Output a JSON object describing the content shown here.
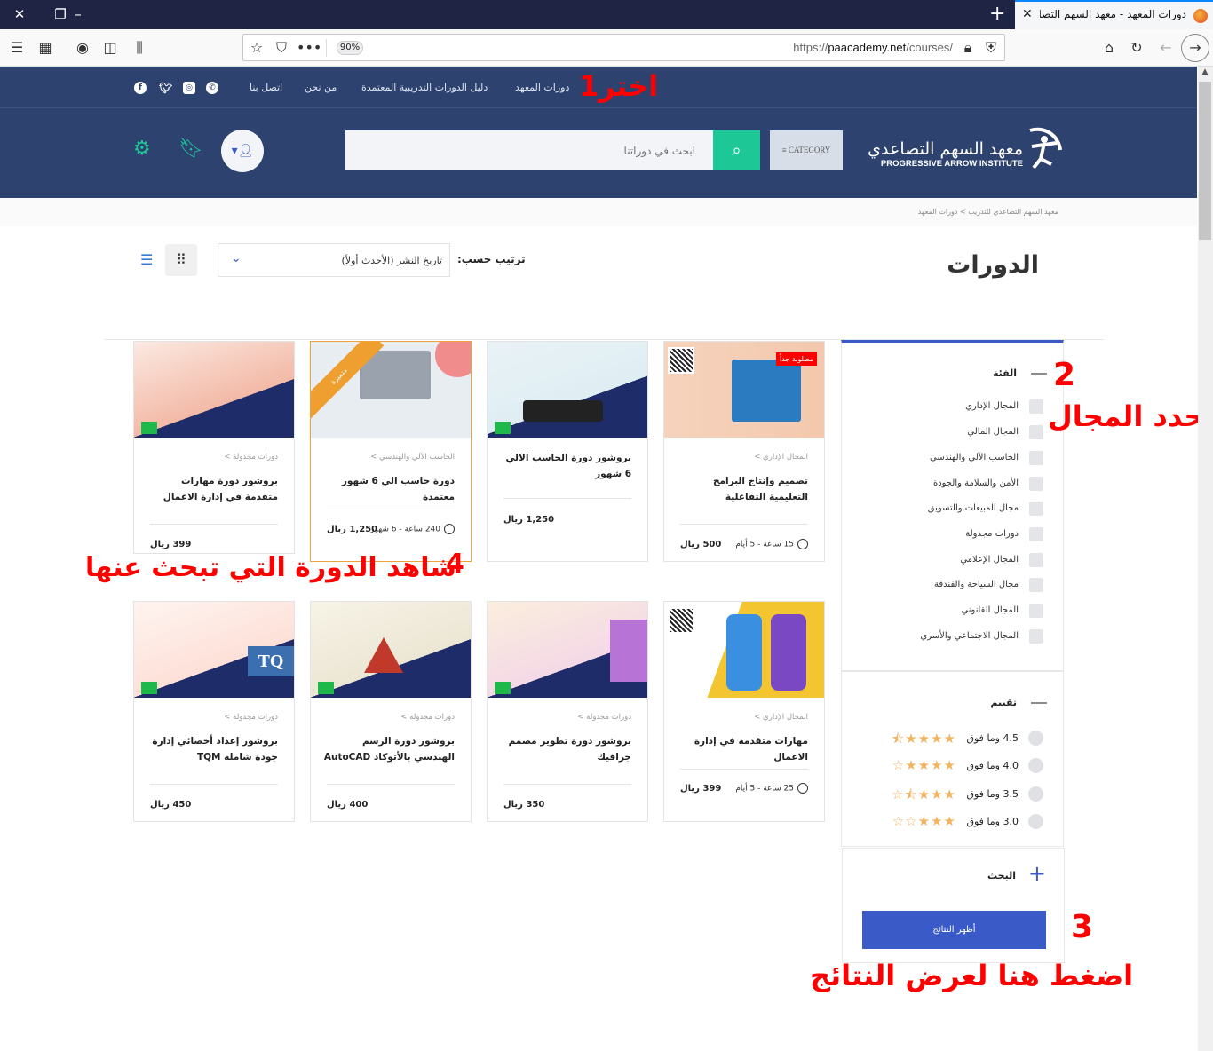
{
  "browser": {
    "tab_title": "دورات المعهد - معهد السهم التصا",
    "url_prefix": "https://",
    "url_domain": "paacademy.net",
    "url_path": "/courses/",
    "zoom_level": "90%"
  },
  "topnav": {
    "items": [
      "دورات المعهد",
      "دليل الدورات التدريبية المعتمدة",
      "من نحن",
      "اتصل بنا"
    ],
    "social": [
      "whatsapp-icon",
      "instagram-icon",
      "twitter-icon",
      "facebook-icon"
    ]
  },
  "header": {
    "logo_ar": "معهد السهم التصاعدي",
    "logo_en": "PROGRESSIVE ARROW INSTITUTE",
    "category_label": "≡ CATEGORY",
    "search_placeholder": "ابحث في دوراتنا"
  },
  "breadcrumb": "معهد السهم التصاعدي للتدريب > دورات المعهد",
  "page_title": "الدورات",
  "sort": {
    "label": "ترتيب حسب:",
    "selected": "تاريخ النشر (الأحدث أولاً)"
  },
  "filters": {
    "category_heading": "الفئة",
    "categories": [
      "المجال الإداري",
      "المجال المالي",
      "الحاسب الآلي والهندسي",
      "الأمن والسلامة والجودة",
      "مجال المبيعات والتسويق",
      "دورات مجدولة",
      "المجال الإعلامي",
      "مجال السياحة والفندقة",
      "المجال القانوني",
      "المجال الاجتماعي والأسري"
    ],
    "rating_heading": "تقييم",
    "ratings": [
      {
        "label": "4.5 وما فوق",
        "stars": 4.5
      },
      {
        "label": "4.0 وما فوق",
        "stars": 4.0
      },
      {
        "label": "3.5 وما فوق",
        "stars": 3.5
      },
      {
        "label": "3.0 وما فوق",
        "stars": 3.0
      }
    ],
    "search_heading": "البحث",
    "show_results": "أظهر النتائج"
  },
  "courses": [
    {
      "category": "المجال الإداري >",
      "title": "تصميم وإنتاج البرامج التعليمية التفاعلية",
      "meta": "15 ساعة - 5 أيام",
      "price": "500 ريال",
      "badge": "مطلوبة جداً"
    },
    {
      "category": "",
      "title": "بروشور دورة الحاسب الالي 6 شهور",
      "meta": "",
      "price": "1,250 ريال",
      "badge": ""
    },
    {
      "category": "الحاسب الآلي والهندسي >",
      "title": "دورة حاسب الي 6 شهور معتمدة",
      "meta": "240 ساعة - 6 شهور",
      "price": "1,250 ريال",
      "ribbon": "متميزة"
    },
    {
      "category": "دورات مجدولة >",
      "title": "بروشور دورة مهارات متقدمة في إدارة الاعمال",
      "meta": "",
      "price": "399 ريال",
      "badge": ""
    },
    {
      "category": "المجال الإداري >",
      "title": "مهارات متقدمة في إدارة الاعمال",
      "meta": "25 ساعة - 5 أيام",
      "price": "399 ريال",
      "badge": ""
    },
    {
      "category": "دورات مجدولة >",
      "title": "بروشور دورة تطوير مصمم جرافيك",
      "meta": "",
      "price": "350 ريال",
      "badge": ""
    },
    {
      "category": "دورات مجدولة >",
      "title": "بروشور دورة الرسم الهندسي بالأتوكاد AutoCAD",
      "meta": "",
      "price": "400 ريال",
      "badge": ""
    },
    {
      "category": "دورات مجدولة >",
      "title": "بروشور إعداد أخصائي إدارة جودة شاملة TQM",
      "meta": "",
      "price": "450 ريال",
      "badge": ""
    }
  ],
  "annotations": {
    "step1": "اختر1",
    "step2_num": "2",
    "step2": "حدد المجال",
    "step3_num": "3",
    "step3": "اضغط هنا لعرض النتائج",
    "step4_num": "4",
    "step4": "شاهد الدورة التي تبحث عنها"
  },
  "colors": {
    "header_bg": "#2d426f",
    "accent_green": "#1ec896",
    "accent_blue": "#3a5bc7",
    "star": "#f2b45f",
    "annotation": "#ff0000"
  }
}
